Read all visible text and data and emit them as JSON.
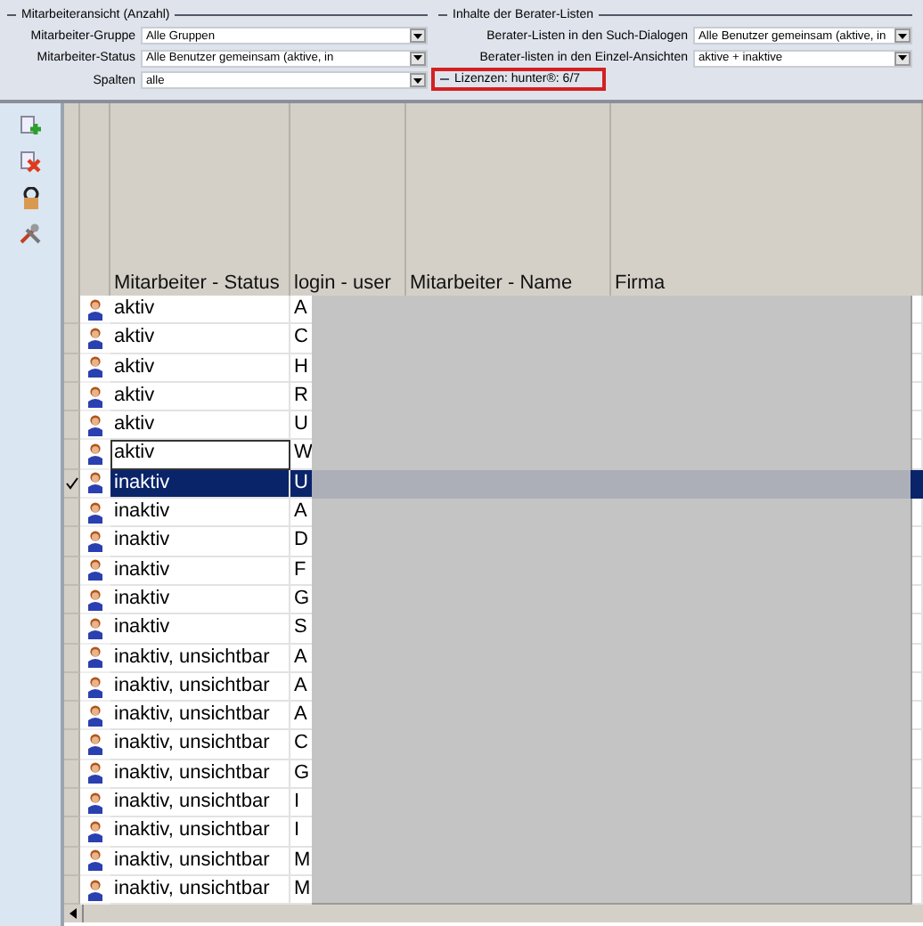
{
  "filter_panel": {
    "left_group": {
      "title": "Mitarbeiteransicht (Anzahl)",
      "fields": [
        {
          "label": "Mitarbeiter-Gruppe",
          "value": "Alle Gruppen"
        },
        {
          "label": "Mitarbeiter-Status",
          "value": "Alle Benutzer gemeinsam (aktive, in"
        },
        {
          "label": "Spalten",
          "value": "alle"
        }
      ]
    },
    "right_group": {
      "title": "Inhalte der Berater-Listen",
      "fields": [
        {
          "label": "Berater-Listen in den Such-Dialogen",
          "value": "Alle Benutzer gemeinsam (aktive, in"
        },
        {
          "label": "Berater-listen in den Einzel-Ansichten",
          "value": "aktive + inaktive"
        }
      ]
    },
    "license": {
      "text": "Lizenzen: hunter®: 6/7",
      "highlighted": true
    }
  },
  "table": {
    "columns": [
      "Mitarbeiter - Status",
      "login - user",
      "Mitarbeiter - Name",
      "Firma"
    ],
    "rows": [
      {
        "status": "aktiv",
        "login": "A",
        "selected": false,
        "focused": false
      },
      {
        "status": "aktiv",
        "login": "C",
        "selected": false,
        "focused": false
      },
      {
        "status": "aktiv",
        "login": "H",
        "selected": false,
        "focused": false
      },
      {
        "status": "aktiv",
        "login": "R",
        "selected": false,
        "focused": false
      },
      {
        "status": "aktiv",
        "login": "U",
        "selected": false,
        "focused": false
      },
      {
        "status": "aktiv",
        "login": "W",
        "selected": false,
        "focused": true
      },
      {
        "status": "inaktiv",
        "login": "U",
        "selected": true,
        "focused": false
      },
      {
        "status": "inaktiv",
        "login": "A",
        "selected": false,
        "focused": false
      },
      {
        "status": "inaktiv",
        "login": "D",
        "selected": false,
        "focused": false
      },
      {
        "status": "inaktiv",
        "login": "F",
        "selected": false,
        "focused": false
      },
      {
        "status": "inaktiv",
        "login": "G",
        "selected": false,
        "focused": false
      },
      {
        "status": "inaktiv",
        "login": "S",
        "selected": false,
        "focused": false
      },
      {
        "status": "inaktiv, unsichtbar",
        "login": "A",
        "selected": false,
        "focused": false
      },
      {
        "status": "inaktiv, unsichtbar",
        "login": "A",
        "selected": false,
        "focused": false
      },
      {
        "status": "inaktiv, unsichtbar",
        "login": "A",
        "selected": false,
        "focused": false
      },
      {
        "status": "inaktiv, unsichtbar",
        "login": "C",
        "selected": false,
        "focused": false
      },
      {
        "status": "inaktiv, unsichtbar",
        "login": "G",
        "selected": false,
        "focused": false
      },
      {
        "status": "inaktiv, unsichtbar",
        "login": "I",
        "selected": false,
        "focused": false
      },
      {
        "status": "inaktiv, unsichtbar",
        "login": "I",
        "selected": false,
        "focused": false
      },
      {
        "status": "inaktiv, unsichtbar",
        "login": "M",
        "selected": false,
        "focused": false
      },
      {
        "status": "inaktiv, unsichtbar",
        "login": "M",
        "selected": false,
        "focused": false
      }
    ]
  }
}
